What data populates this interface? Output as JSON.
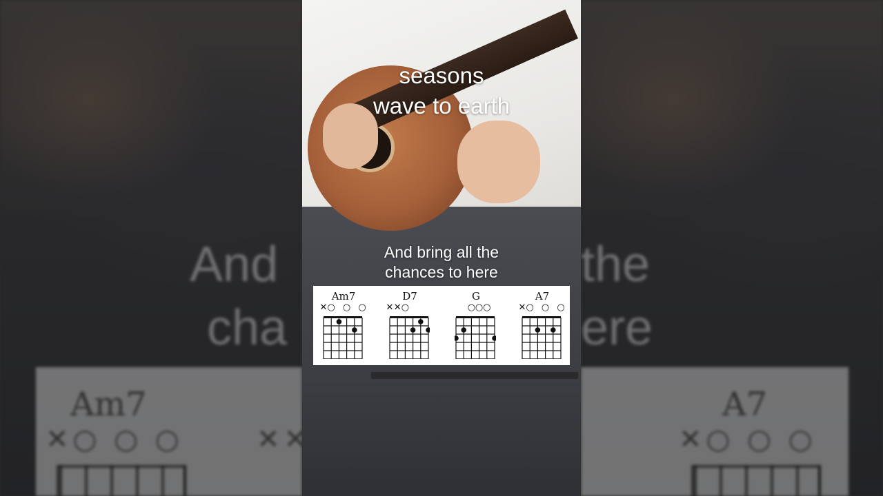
{
  "video": {
    "title_lines": [
      "seasons",
      "wave to earth"
    ],
    "lyric_lines": [
      "And bring all the",
      "chances to here"
    ]
  },
  "background": {
    "lyric_left": [
      "And",
      "cha"
    ],
    "lyric_right": [
      "the",
      "ere"
    ],
    "chord_left": "Am7",
    "chord_right": "A7"
  },
  "chords": [
    {
      "name": "Am7",
      "marks": [
        "x",
        "o",
        "",
        "o",
        "",
        "o"
      ],
      "dots": [
        {
          "string": 4,
          "fret": 1
        },
        {
          "string": 2,
          "fret": 2
        }
      ]
    },
    {
      "name": "D7",
      "marks": [
        "x",
        "x",
        "o",
        "",
        "",
        ""
      ],
      "dots": [
        {
          "string": 3,
          "fret": 2
        },
        {
          "string": 2,
          "fret": 1
        },
        {
          "string": 1,
          "fret": 2
        }
      ]
    },
    {
      "name": "G",
      "marks": [
        "",
        "",
        "o",
        "o",
        "o",
        ""
      ],
      "dots": [
        {
          "string": 6,
          "fret": 3
        },
        {
          "string": 5,
          "fret": 2
        },
        {
          "string": 1,
          "fret": 3
        }
      ]
    },
    {
      "name": "A7",
      "marks": [
        "x",
        "o",
        "",
        "o",
        "",
        "o"
      ],
      "dots": [
        {
          "string": 4,
          "fret": 2
        },
        {
          "string": 2,
          "fret": 2
        }
      ]
    }
  ],
  "colors": {
    "card": "#ffffff",
    "ink": "#111111",
    "overlay_text": "#ffffff"
  }
}
